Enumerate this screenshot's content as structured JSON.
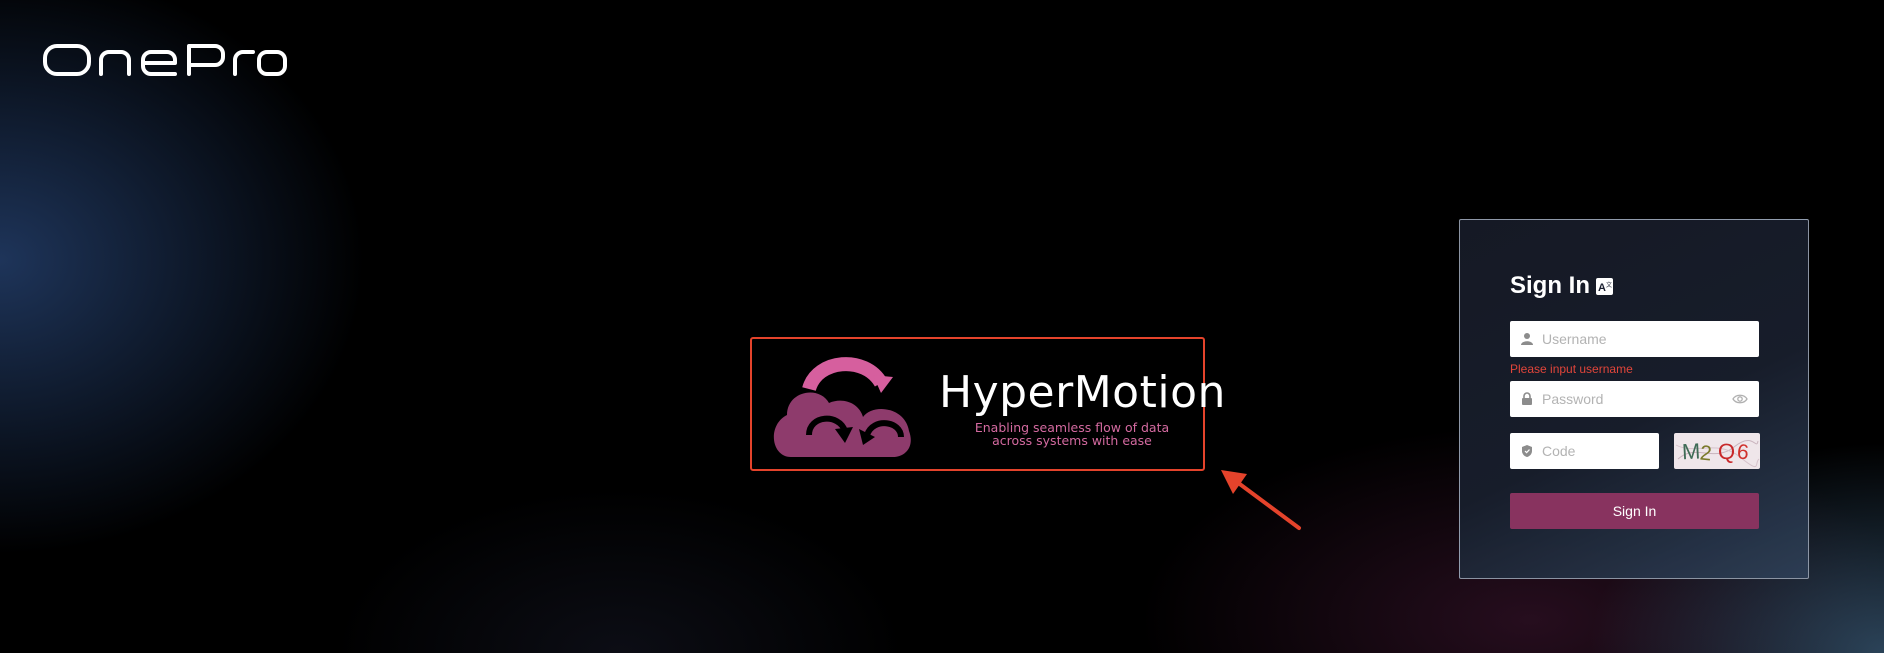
{
  "brand": {
    "name": "OnePro"
  },
  "promo": {
    "title": "HyperMotion",
    "tagline_line1": "Enabling seamless flow of data",
    "tagline_line2": "across systems with ease",
    "highlight_color": "#e4432b",
    "icon": "cloud-sync-icon"
  },
  "login": {
    "title": "Sign In",
    "language_icon": "translate-icon",
    "username": {
      "placeholder": "Username",
      "value": "",
      "icon": "user-icon"
    },
    "username_error": "Please input username",
    "password": {
      "placeholder": "Password",
      "value": "",
      "icon": "lock-icon",
      "toggle_icon": "eye-icon"
    },
    "code": {
      "placeholder": "Code",
      "value": "",
      "icon": "shield-icon"
    },
    "captcha_text": "M2Q6",
    "submit_label": "Sign In",
    "accent_color": "#88335f",
    "error_color": "#e0453a"
  }
}
